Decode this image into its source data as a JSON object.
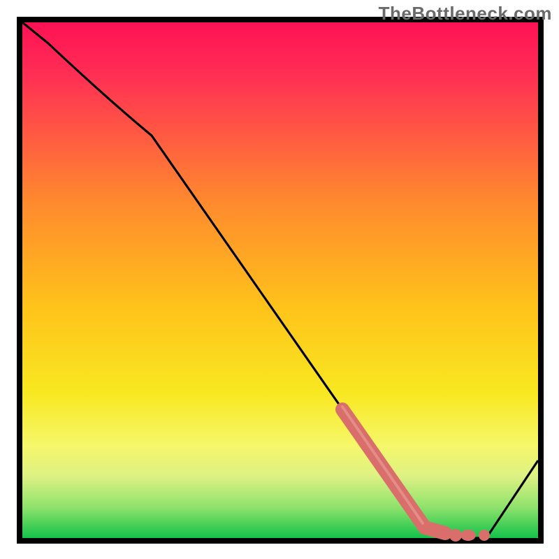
{
  "watermark": "TheBottleneck.com",
  "chart_data": {
    "type": "line",
    "title": "",
    "xlabel": "",
    "ylabel": "",
    "xlim": [
      0,
      100
    ],
    "ylim": [
      0,
      100
    ],
    "grid": false,
    "series": [
      {
        "name": "curve",
        "x": [
          0,
          5,
          25,
          78,
          84,
          90,
          100
        ],
        "values": [
          100,
          96,
          78,
          2,
          0,
          0,
          15
        ]
      }
    ],
    "highlight_band": {
      "name": "optimal-zone",
      "x_start": 62,
      "x_end": 88,
      "values_along_curve": [
        {
          "x": 62,
          "y": 25
        },
        {
          "x": 78,
          "y": 2
        },
        {
          "x": 82,
          "y": 1
        },
        {
          "x": 84,
          "y": 0.5
        },
        {
          "x": 86,
          "y": 0.5
        },
        {
          "x": 88,
          "y": 0.5
        }
      ]
    },
    "background_gradient": {
      "top_color": "#FF1E56",
      "mid_color": "#FFD400",
      "bottom_color": "#13C24A"
    }
  }
}
